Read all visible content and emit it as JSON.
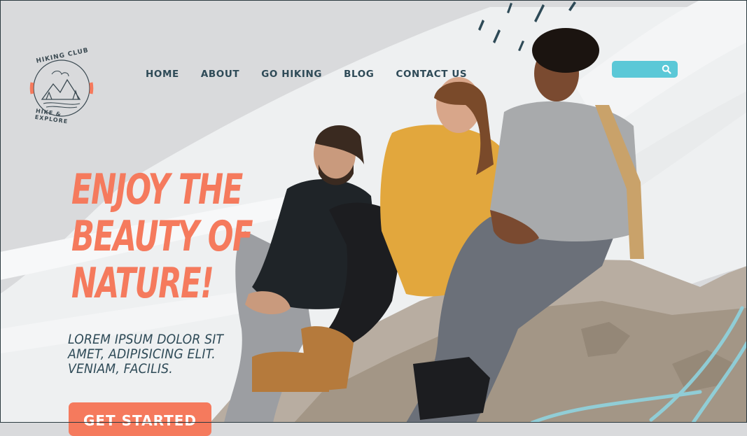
{
  "logo": {
    "top_text": "HIKING CLUB",
    "bottom_text": "HIKE & EXPLORE",
    "icon": "mountain-icon"
  },
  "nav": {
    "items": [
      {
        "label": "HOME"
      },
      {
        "label": "ABOUT"
      },
      {
        "label": "GO HIKING"
      },
      {
        "label": "BLOG"
      },
      {
        "label": "CONTACT US"
      }
    ]
  },
  "search": {
    "placeholder": "",
    "icon": "search-icon"
  },
  "hero": {
    "headline": "ENJOY THE\nBEAUTY OF\nNATURE!",
    "subtext": "LOREM IPSUM DOLOR SIT AMET, ADIPISICING ELIT. VENIAM, FACILIS.",
    "cta_label": "GET STARTED"
  },
  "colors": {
    "accent": "#f57a5d",
    "nav_text": "#2e4a57",
    "search_bg": "#5bc8d7",
    "background": "#d9dadc"
  }
}
